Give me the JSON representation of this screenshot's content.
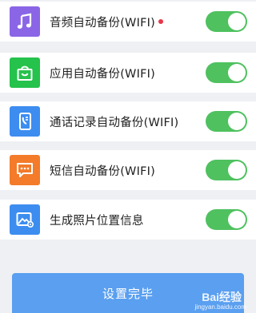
{
  "settings": [
    {
      "label": "音频自动备份(WIFI)",
      "icon": "music-note-icon",
      "icon_bg": "#8a66e6",
      "has_dot": true,
      "enabled": true
    },
    {
      "label": "应用自动备份(WIFI)",
      "icon": "shopping-bag-icon",
      "icon_bg": "#25c24c",
      "has_dot": false,
      "enabled": true
    },
    {
      "label": "通话记录自动备份(WIFI)",
      "icon": "phone-log-icon",
      "icon_bg": "#3d8df0",
      "has_dot": false,
      "enabled": true
    },
    {
      "label": "短信自动备份(WIFI)",
      "icon": "message-bubble-icon",
      "icon_bg": "#f37b2a",
      "has_dot": false,
      "enabled": true
    },
    {
      "label": "生成照片位置信息",
      "icon": "photo-location-icon",
      "icon_bg": "#3d8df0",
      "has_dot": false,
      "enabled": true
    }
  ],
  "colors": {
    "toggle_on": "#4fc15f",
    "button_bg": "#5a9ff0",
    "dot": "#e8364a"
  },
  "footer": {
    "setup_button_label": "设置完毕"
  },
  "watermark": {
    "brand": "Bai经验",
    "url": "jingyan.baidu.com"
  }
}
